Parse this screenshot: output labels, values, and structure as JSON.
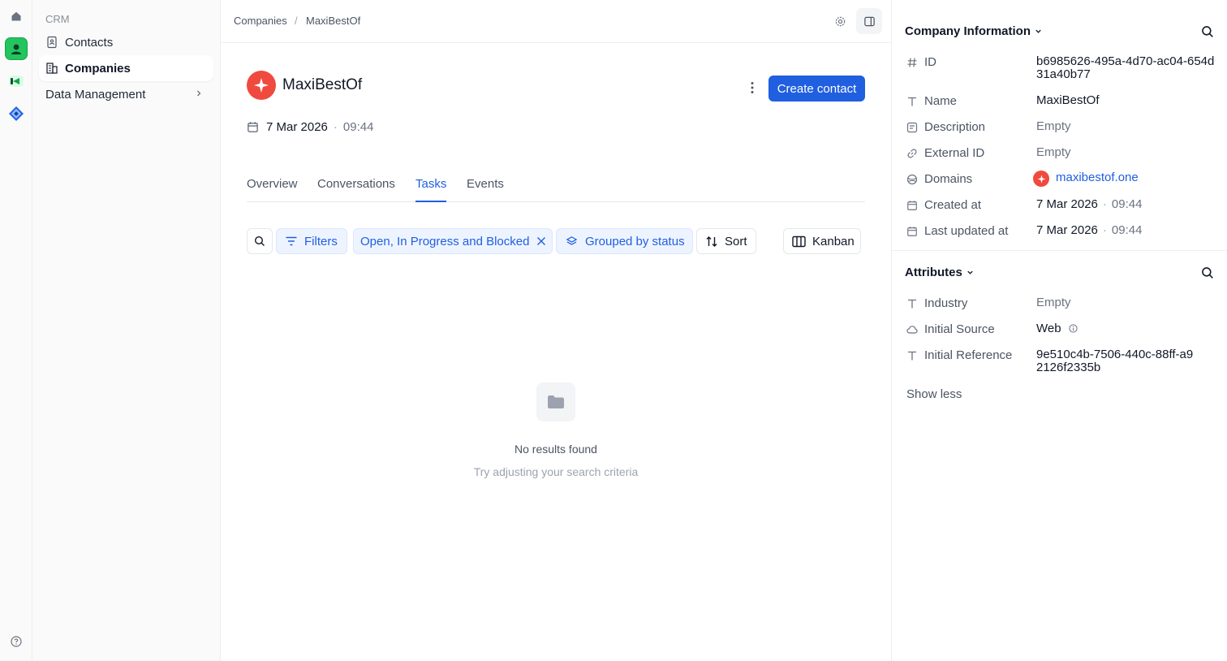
{
  "sidebar": {
    "section": "CRM",
    "items": [
      {
        "label": "Contacts"
      },
      {
        "label": "Companies"
      },
      {
        "label": "Data Management"
      }
    ]
  },
  "breadcrumb": {
    "parent": "Companies",
    "separator": "/",
    "current": "MaxiBestOf"
  },
  "company": {
    "name": "MaxiBestOf",
    "date": "7 Mar 2026",
    "dot": "·",
    "time": "09:44"
  },
  "actions": {
    "create_contact": "Create contact"
  },
  "tabs": [
    {
      "label": "Overview"
    },
    {
      "label": "Conversations"
    },
    {
      "label": "Tasks",
      "active": true
    },
    {
      "label": "Events"
    }
  ],
  "toolbar": {
    "filters": "Filters",
    "status_filter": "Open, In Progress and Blocked",
    "grouping": "Grouped by status",
    "sort": "Sort",
    "view": "Kanban"
  },
  "empty": {
    "title": "No results found",
    "subtitle": "Try adjusting your search criteria"
  },
  "company_info": {
    "title": "Company Information",
    "fields": [
      {
        "label": "ID",
        "value": "b6985626-495a-4d70-ac04-654d31a40b77",
        "icon": "hash-icon"
      },
      {
        "label": "Name",
        "value": "MaxiBestOf",
        "icon": "text-icon"
      },
      {
        "label": "Description",
        "value": "Empty",
        "icon": "note-icon"
      },
      {
        "label": "External ID",
        "value": "Empty",
        "icon": "link-icon"
      },
      {
        "label": "Domains",
        "value": "maxibestof.one",
        "icon": "globe-icon"
      },
      {
        "label": "Created at",
        "date": "7 Mar 2026",
        "time": "09:44",
        "icon": "calendar-icon"
      },
      {
        "label": "Last updated at",
        "date": "7 Mar 2026",
        "time": "09:44",
        "icon": "calendar-icon"
      }
    ]
  },
  "attributes": {
    "title": "Attributes",
    "fields": [
      {
        "label": "Industry",
        "value": "Empty",
        "icon": "text-icon"
      },
      {
        "label": "Initial Source",
        "value": "Web",
        "icon": "cloud-icon"
      },
      {
        "label": "Initial Reference",
        "value": "9e510c4b-7506-440c-88ff-a92126f2335b",
        "icon": "text-icon"
      }
    ],
    "show_less": "Show less"
  },
  "colors": {
    "accent": "#1f5fe0",
    "brand": "#f04a3e",
    "chip_bg": "#eef4ff"
  }
}
